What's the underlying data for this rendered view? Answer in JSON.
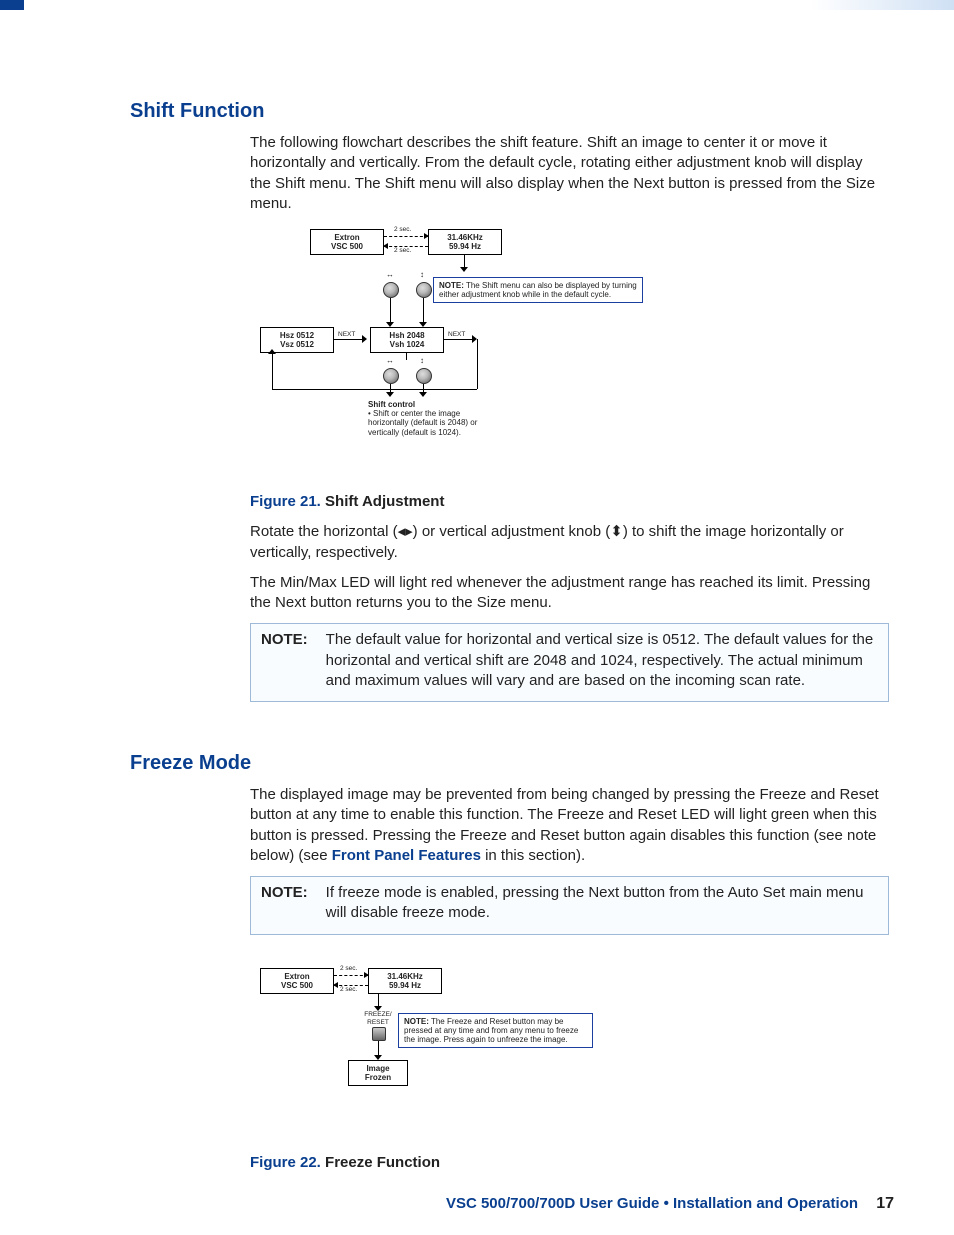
{
  "sections": {
    "shift": {
      "heading": "Shift Function",
      "intro": "The following flowchart describes the shift feature. Shift an image to center it or move it horizontally and vertically.  From the default cycle, rotating either adjustment knob will display the Shift menu. The Shift menu will also display when the Next button is pressed from the Size menu.",
      "fig": {
        "label": "Figure 21.",
        "title": "Shift Adjustment"
      },
      "p2_a": "Rotate the horizontal (",
      "p2_b": ") or vertical adjustment knob (",
      "p2_c": ") to shift the image horizontally or vertically, respectively.",
      "p3": "The Min/Max LED will light red whenever the adjustment range has reached its limit. Pressing the Next button returns you to the Size menu.",
      "note": {
        "label": "NOTE:",
        "text": "The default value for horizontal and vertical size is 0512.  The default values for the horizontal and vertical shift are 2048 and 1024, respectively.  The actual minimum and maximum values will vary and are based on the incoming scan rate."
      },
      "diagram": {
        "top_left": "Extron\nVSC  500",
        "top_right": "31.46KHz\n59.94 Hz",
        "sec2": "2 sec.",
        "note": "The Shift menu can also be displayed by turning either adjustment knob while in the default cycle.",
        "note_label": "NOTE:",
        "size_box": "Hsz  0512\nVsz  0512",
        "shift_box": "Hsh  2048\nVsh  1024",
        "next": "NEXT",
        "shift_desc_title": "Shift control",
        "shift_desc_body": "Shift or center the image horizontally (default is 2048) or vertically (default is 1024)."
      }
    },
    "freeze": {
      "heading": "Freeze Mode",
      "intro_a": "The displayed image may be prevented from being changed by pressing the Freeze and Reset button at any time to enable this function.  The Freeze and Reset LED will light green when this button is pressed.  Pressing the Freeze and Reset button again disables this function (see note below) (see ",
      "link": "Front Panel Features",
      "intro_b": " in this section).",
      "note": {
        "label": "NOTE:",
        "text": "If freeze mode is enabled, pressing the Next button from the Auto Set main menu will disable freeze mode."
      },
      "fig": {
        "label": "Figure 22.",
        "title": "Freeze Function"
      },
      "diagram": {
        "top_left": "Extron\nVSC  500",
        "top_right": "31.46KHz\n59.94 Hz",
        "sec2": "2 sec.",
        "btn_label": "FREEZE/\nRESET",
        "frozen": "Image\nFrozen",
        "note_label": "NOTE:",
        "note": "The Freeze and Reset button may be pressed at any time and from any menu to freeze the image. Press again to unfreeze the image."
      }
    }
  },
  "footer": {
    "title": "VSC 500/700/700D User Guide",
    "bullet": "•",
    "section": "Installation and Operation",
    "page": "17"
  }
}
